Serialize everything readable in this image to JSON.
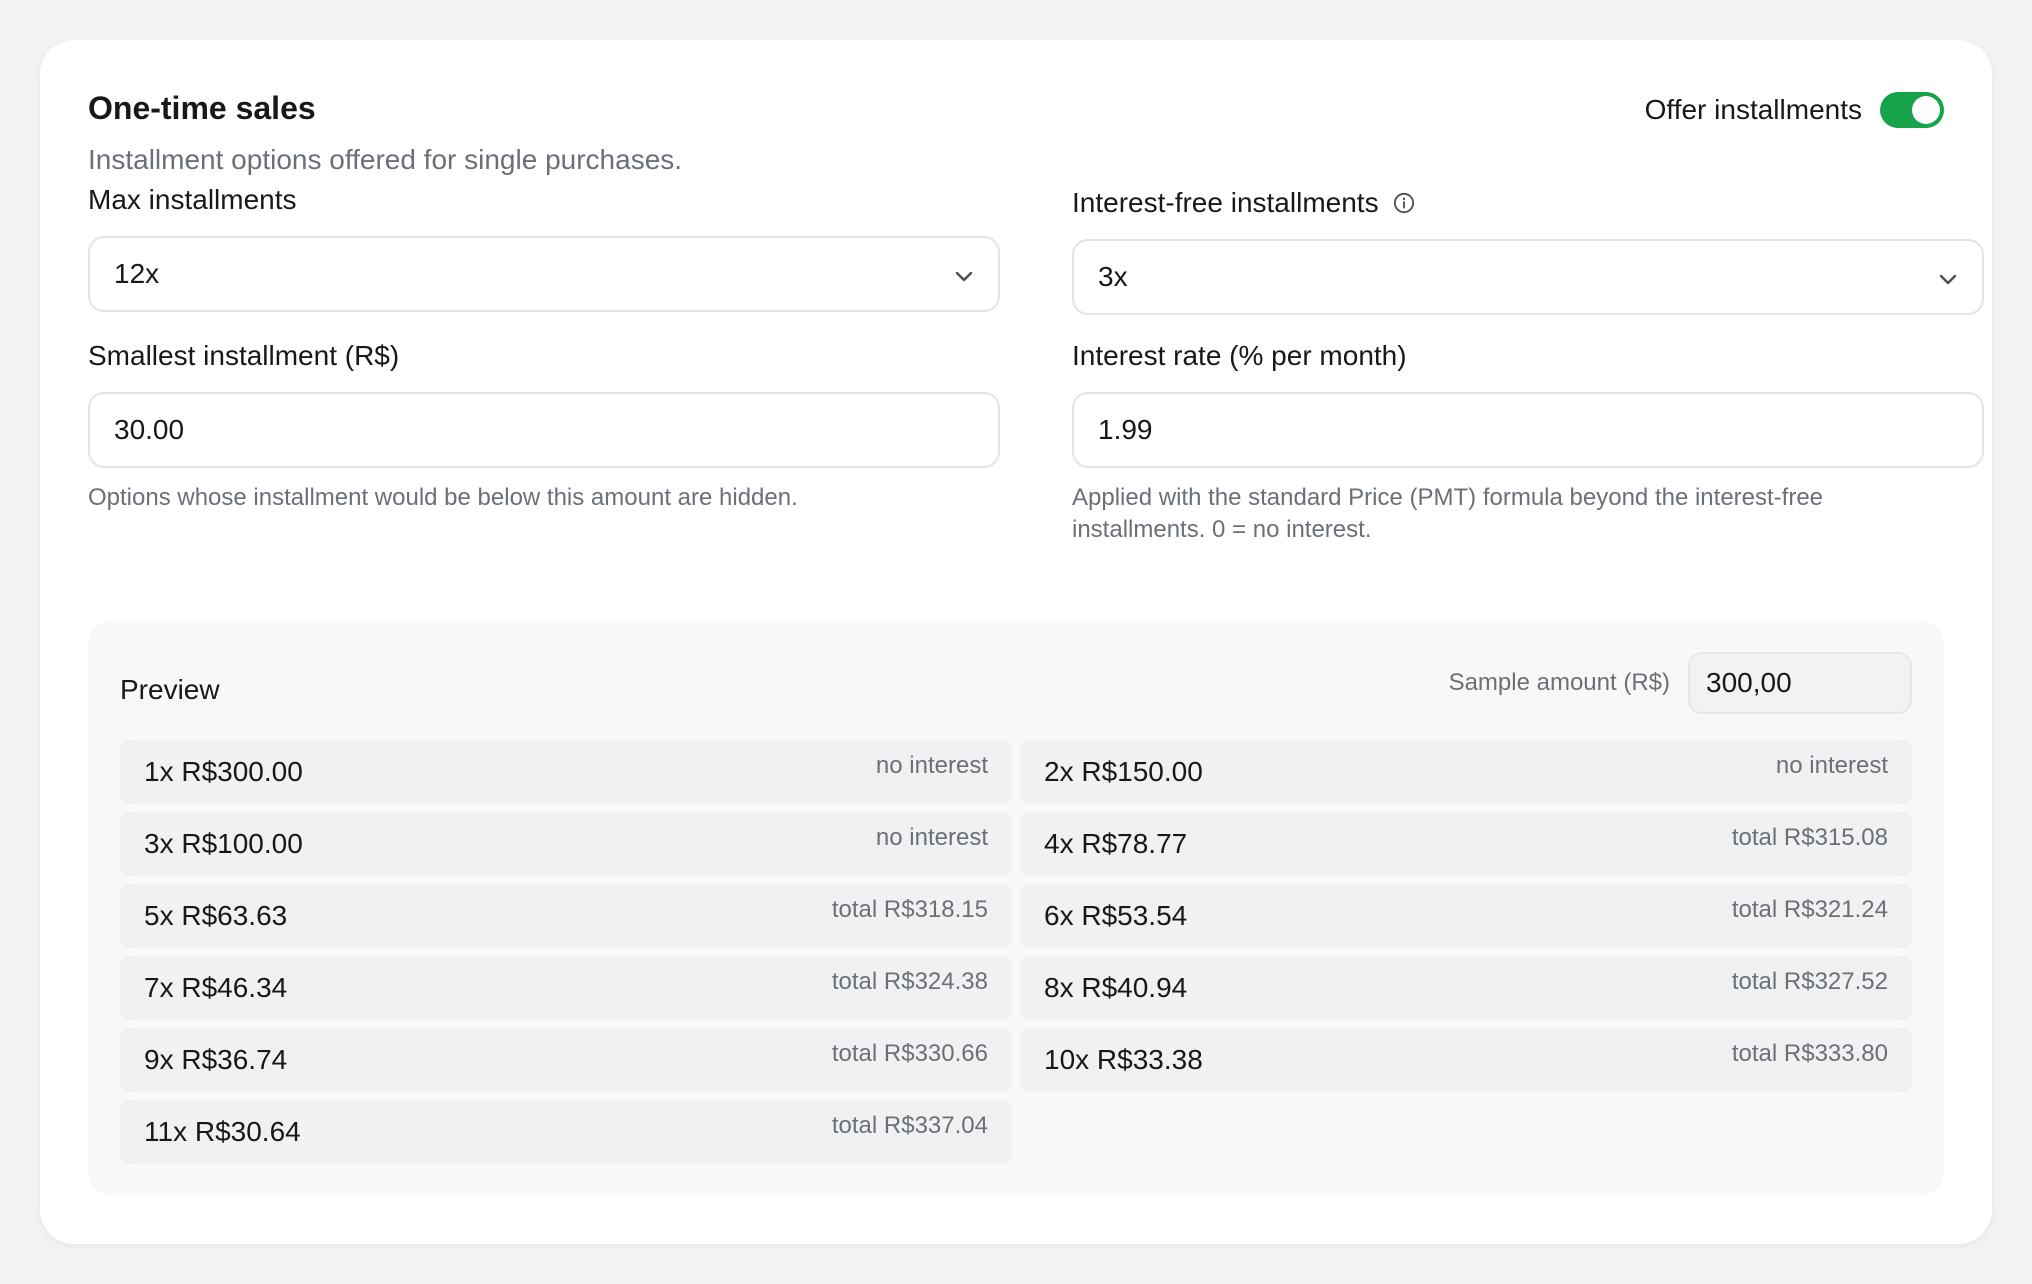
{
  "header": {
    "title": "One-time sales",
    "subtitle": "Installment options offered for single purchases.",
    "toggle_label": "Offer installments",
    "toggle_on": true
  },
  "fields": {
    "max_installments": {
      "label": "Max installments",
      "value": "12x"
    },
    "interest_free": {
      "label": "Interest-free installments",
      "value": "3x"
    },
    "smallest_installment": {
      "label": "Smallest installment (R$)",
      "value": "30.00",
      "help": "Options whose installment would be below this amount are hidden."
    },
    "interest_rate": {
      "label": "Interest rate (% per month)",
      "value": "1.99",
      "help": "Applied with the standard Price (PMT) formula beyond the interest-free installments. 0 = no interest."
    }
  },
  "preview": {
    "title": "Preview",
    "sample_label": "Sample amount (R$)",
    "sample_value": "300,00",
    "rows": [
      {
        "main": "1x R$300.00",
        "note": "no interest"
      },
      {
        "main": "2x R$150.00",
        "note": "no interest"
      },
      {
        "main": "3x R$100.00",
        "note": "no interest"
      },
      {
        "main": "4x R$78.77",
        "note": "total R$315.08"
      },
      {
        "main": "5x R$63.63",
        "note": "total R$318.15"
      },
      {
        "main": "6x R$53.54",
        "note": "total R$321.24"
      },
      {
        "main": "7x R$46.34",
        "note": "total R$324.38"
      },
      {
        "main": "8x R$40.94",
        "note": "total R$327.52"
      },
      {
        "main": "9x R$36.74",
        "note": "total R$330.66"
      },
      {
        "main": "10x R$33.38",
        "note": "total R$333.80"
      },
      {
        "main": "11x R$30.64",
        "note": "total R$337.04"
      }
    ]
  },
  "colors": {
    "accent": "#16a34a",
    "muted_text": "#6b7077",
    "row_bg": "#f0f1f2"
  },
  "icons": [
    "chevron-down-icon",
    "info-icon"
  ]
}
